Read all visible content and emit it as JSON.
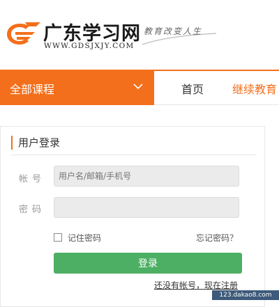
{
  "header": {
    "site_title": "广东学习网",
    "site_url": "WWW.GDSJXJY.COM",
    "slogan": "教育改变人生"
  },
  "nav": {
    "all_courses": "全部课程",
    "home": "首页",
    "continuing_edu": "继续教育"
  },
  "login": {
    "title": "用户登录",
    "username_label": "帐号",
    "username_placeholder": "用户名/邮箱/手机号",
    "password_label": "密码",
    "remember_label": "记住密码",
    "forgot_label": "忘记密码？",
    "submit_label": "登录",
    "register_label": "还没有帐号，现在注册"
  },
  "watermark": "123.dakao8.com",
  "colors": {
    "accent": "#f46f1b",
    "login_button": "#4caf63",
    "input_bg": "#ebebeb"
  }
}
